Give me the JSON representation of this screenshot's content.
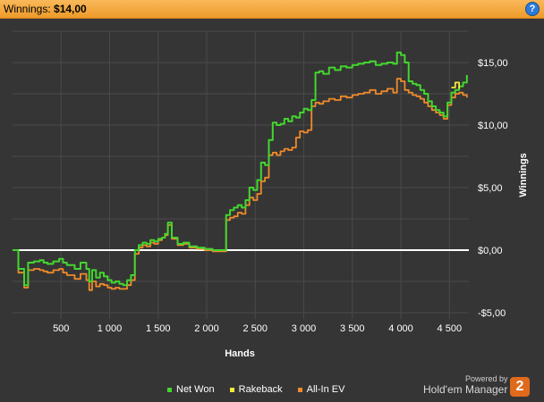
{
  "header": {
    "label": "Winnings:",
    "value": "$14,00",
    "help": "?"
  },
  "chart_data": {
    "type": "line",
    "title": "",
    "xlabel": "Hands",
    "ylabel": "Winnings",
    "xlim": [
      0,
      4700
    ],
    "ylim": [
      -5.5,
      17.5
    ],
    "x_ticks": [
      500,
      1000,
      1500,
      2000,
      2500,
      3000,
      3500,
      4000,
      4500
    ],
    "x_tick_labels": [
      "500",
      "1 000",
      "1 500",
      "2 000",
      "2 500",
      "3 000",
      "3 500",
      "4 000",
      "4 500"
    ],
    "y_ticks": [
      -5,
      0,
      5,
      10,
      15
    ],
    "y_tick_labels": [
      "-$5,00",
      "$0,00",
      "$5,00",
      "$10,00",
      "$15,00"
    ],
    "grid": true,
    "legend_position": "bottom",
    "series": [
      {
        "name": "Net Won",
        "color": "#43d62f",
        "x": [
          0,
          60,
          120,
          160,
          220,
          280,
          320,
          360,
          420,
          480,
          520,
          560,
          640,
          700,
          760,
          790,
          820,
          860,
          900,
          940,
          980,
          1020,
          1060,
          1100,
          1140,
          1180,
          1220,
          1260,
          1300,
          1340,
          1380,
          1420,
          1460,
          1500,
          1540,
          1570,
          1600,
          1640,
          1700,
          1760,
          1820,
          1900,
          1980,
          2060,
          2160,
          2200,
          2240,
          2280,
          2320,
          2360,
          2400,
          2440,
          2480,
          2520,
          2560,
          2600,
          2640,
          2680,
          2720,
          2760,
          2800,
          2840,
          2880,
          2920,
          2960,
          3000,
          3040,
          3080,
          3120,
          3160,
          3200,
          3260,
          3320,
          3380,
          3440,
          3500,
          3560,
          3620,
          3680,
          3740,
          3800,
          3860,
          3920,
          3960,
          4000,
          4040,
          4080,
          4120,
          4160,
          4200,
          4240,
          4280,
          4320,
          4360,
          4400,
          4440,
          4480,
          4520,
          4560,
          4600,
          4640,
          4680
        ],
        "y": [
          0,
          -1.5,
          -2.8,
          -1.0,
          -0.9,
          -0.8,
          -1.0,
          -1.1,
          -0.9,
          -0.7,
          -1.0,
          -1.2,
          -1.5,
          -1.0,
          -1.5,
          -2.5,
          -1.6,
          -2.2,
          -1.8,
          -2.1,
          -2.4,
          -2.6,
          -2.5,
          -2.7,
          -2.8,
          -2.4,
          -2.0,
          0.0,
          0.4,
          0.6,
          0.5,
          0.8,
          0.7,
          0.9,
          1.0,
          1.3,
          2.2,
          1.0,
          0.5,
          0.6,
          0.3,
          0.2,
          0.1,
          0.0,
          0.0,
          2.8,
          3.2,
          3.4,
          3.6,
          3.4,
          4.0,
          5.0,
          4.8,
          5.6,
          7.0,
          6.8,
          8.8,
          10.2,
          10.0,
          10.1,
          10.5,
          10.3,
          10.7,
          10.6,
          11.0,
          11.3,
          11.2,
          12.0,
          14.2,
          14.3,
          14.1,
          14.6,
          14.4,
          14.7,
          14.6,
          14.8,
          14.9,
          15.0,
          15.1,
          14.8,
          14.9,
          15.0,
          14.9,
          15.8,
          15.6,
          15.0,
          13.5,
          13.3,
          13.2,
          12.8,
          12.5,
          11.9,
          11.5,
          11.2,
          11.0,
          10.7,
          11.8,
          12.6,
          12.8,
          13.1,
          13.4,
          14.0
        ]
      },
      {
        "name": "Rakeback",
        "color": "#f2ea3a",
        "x": [
          4520,
          4560,
          4600
        ],
        "y": [
          13.0,
          13.4,
          12.9
        ]
      },
      {
        "name": "All-In EV",
        "color": "#f08a2a",
        "x": [
          0,
          60,
          120,
          160,
          220,
          280,
          320,
          360,
          420,
          480,
          520,
          560,
          640,
          700,
          760,
          790,
          820,
          860,
          900,
          940,
          980,
          1020,
          1060,
          1100,
          1140,
          1180,
          1220,
          1260,
          1300,
          1340,
          1380,
          1420,
          1460,
          1500,
          1540,
          1570,
          1600,
          1640,
          1700,
          1760,
          1820,
          1900,
          1980,
          2060,
          2160,
          2200,
          2240,
          2280,
          2320,
          2360,
          2400,
          2440,
          2480,
          2520,
          2560,
          2600,
          2640,
          2680,
          2720,
          2760,
          2800,
          2840,
          2880,
          2920,
          2960,
          3000,
          3040,
          3080,
          3120,
          3160,
          3200,
          3260,
          3320,
          3380,
          3440,
          3500,
          3560,
          3620,
          3680,
          3740,
          3800,
          3860,
          3920,
          3960,
          4000,
          4040,
          4080,
          4120,
          4160,
          4200,
          4240,
          4280,
          4320,
          4360,
          4400,
          4440,
          4480,
          4520,
          4560,
          4600,
          4640,
          4680
        ],
        "y": [
          0,
          -1.8,
          -3.0,
          -1.6,
          -1.5,
          -1.6,
          -1.7,
          -1.8,
          -1.6,
          -1.5,
          -1.8,
          -2.0,
          -2.3,
          -1.9,
          -2.4,
          -3.2,
          -2.5,
          -2.9,
          -2.7,
          -2.8,
          -3.0,
          -3.1,
          -3.0,
          -3.1,
          -3.1,
          -2.8,
          -2.4,
          -0.3,
          0.2,
          0.4,
          0.3,
          0.6,
          0.5,
          0.8,
          1.0,
          1.2,
          2.0,
          0.9,
          0.4,
          0.5,
          0.2,
          0.1,
          0.0,
          -0.1,
          -0.1,
          2.4,
          2.6,
          2.7,
          3.0,
          2.9,
          3.6,
          4.2,
          4.0,
          4.5,
          5.5,
          5.8,
          7.6,
          7.8,
          7.6,
          7.9,
          8.1,
          8.0,
          8.2,
          9.0,
          9.5,
          9.4,
          9.6,
          11.5,
          11.8,
          11.7,
          11.9,
          12.1,
          12.0,
          12.3,
          12.2,
          12.4,
          12.5,
          12.6,
          12.8,
          12.5,
          12.7,
          12.9,
          12.6,
          13.7,
          13.5,
          12.8,
          12.6,
          12.4,
          12.3,
          12.1,
          11.8,
          11.5,
          11.2,
          11.0,
          10.8,
          10.5,
          11.6,
          12.2,
          12.5,
          12.6,
          12.4,
          12.2
        ]
      }
    ]
  }
}
